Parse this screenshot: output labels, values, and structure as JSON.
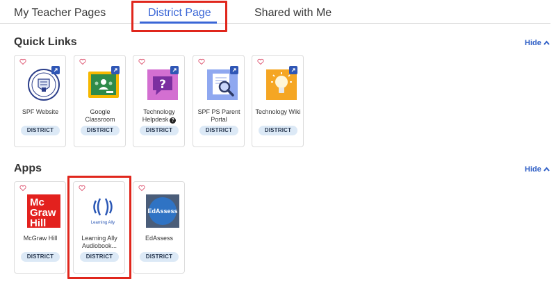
{
  "tabs": {
    "my_teacher_pages": "My Teacher Pages",
    "district_page": "District Page",
    "shared_with_me": "Shared with Me"
  },
  "quick_links": {
    "title": "Quick Links",
    "hide_label": "Hide",
    "items": [
      {
        "title": "SPF Website",
        "badge": "DISTRICT",
        "icon": "spf-seal-icon"
      },
      {
        "title": "Google Classroom",
        "badge": "DISTRICT",
        "icon": "google-classroom-icon"
      },
      {
        "title": "Technology Helpdesk",
        "badge": "DISTRICT",
        "icon": "helpdesk-question-icon"
      },
      {
        "title": "SPF PS Parent Portal",
        "badge": "DISTRICT",
        "icon": "parent-portal-search-icon"
      },
      {
        "title": "Technology Wiki",
        "badge": "DISTRICT",
        "icon": "lightbulb-icon"
      }
    ]
  },
  "apps": {
    "title": "Apps",
    "hide_label": "Hide",
    "items": [
      {
        "title": "McGraw Hill",
        "badge": "DISTRICT",
        "icon": "mcgraw-hill-logo",
        "logo_text": [
          "Mc",
          "Graw",
          "Hill"
        ]
      },
      {
        "title": "Learning Ally Audiobook...",
        "badge": "DISTRICT",
        "icon": "learning-ally-logo",
        "logo_text": "Learning Ally"
      },
      {
        "title": "EdAssess",
        "badge": "DISTRICT",
        "icon": "edassess-logo",
        "logo_text": "EdAssess"
      }
    ]
  },
  "colors": {
    "accent": "#3a66d6",
    "highlight_box": "#e0261c",
    "badge_bg": "#dce9f6"
  }
}
